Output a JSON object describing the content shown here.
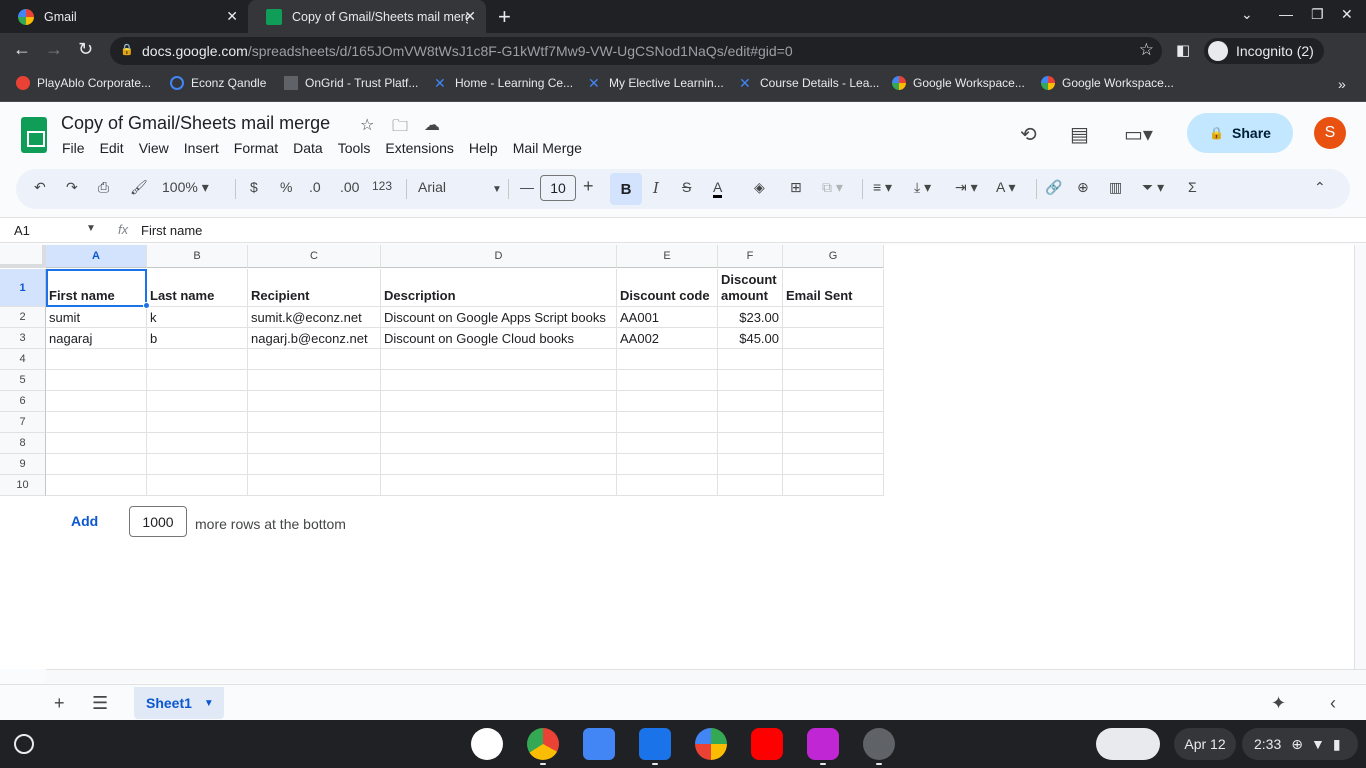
{
  "browser": {
    "tabs": [
      {
        "title": "Gmail",
        "active": false
      },
      {
        "title": "Copy of Gmail/Sheets mail merg",
        "active": true
      }
    ],
    "url_domain": "docs.google.com",
    "url_path": "/spreadsheets/d/165JOmVW8tWsJ1c8F-G1kWtf7Mw9-VW-UgCSNod1NaQs/edit#gid=0",
    "incognito_label": "Incognito (2)",
    "bookmarks": [
      "PlayAblo Corporate...",
      "Econz Qandle",
      "OnGrid - Trust Platf...",
      "Home - Learning Ce...",
      "My Elective Learnin...",
      "Course Details - Lea...",
      "Google Workspace...",
      "Google Workspace..."
    ]
  },
  "doc": {
    "title": "Copy of Gmail/Sheets mail merge",
    "menu": [
      "File",
      "Edit",
      "View",
      "Insert",
      "Format",
      "Data",
      "Tools",
      "Extensions",
      "Help",
      "Mail Merge"
    ],
    "share_label": "Share",
    "avatar_initial": "S"
  },
  "toolbar": {
    "zoom": "100%",
    "currency": "$",
    "percent": "%",
    "dec_decrease": ".0",
    "dec_increase": ".00",
    "number_format": "123",
    "font": "Arial",
    "font_size": "10",
    "bold": "B",
    "italic": "I",
    "text_color_glyph": "A"
  },
  "formula_bar": {
    "cell_ref": "A1",
    "fx": "fx",
    "value": "First name"
  },
  "grid": {
    "columns": [
      "A",
      "B",
      "C",
      "D",
      "E",
      "F",
      "G"
    ],
    "rows": [
      "1",
      "2",
      "3",
      "4",
      "5",
      "6",
      "7",
      "8",
      "9",
      "10"
    ],
    "header": [
      "First name",
      "Last name",
      "Recipient",
      "Description",
      "Discount code",
      "Discount amount",
      "Email Sent"
    ],
    "data": [
      [
        "sumit",
        "k",
        "sumit.k@econz.net",
        "Discount on Google Apps Script books",
        "AA001",
        "$23.00",
        ""
      ],
      [
        "nagaraj",
        "b",
        "nagarj.b@econz.net",
        "Discount on Google Cloud books",
        "AA002",
        "$45.00",
        ""
      ]
    ],
    "add_label": "Add",
    "add_rows_value": "1000",
    "add_rows_text": "more rows at the bottom"
  },
  "sheets": {
    "tabs": [
      "Sheet1"
    ]
  },
  "shelf": {
    "date": "Apr 12",
    "time": "2:33"
  },
  "colors": {
    "accent": "#0b57d0",
    "sheets_green": "#0f9d58",
    "share_bg": "#c2e7ff",
    "avatar_bg": "#e8510f",
    "selection": "#1a73e8"
  }
}
